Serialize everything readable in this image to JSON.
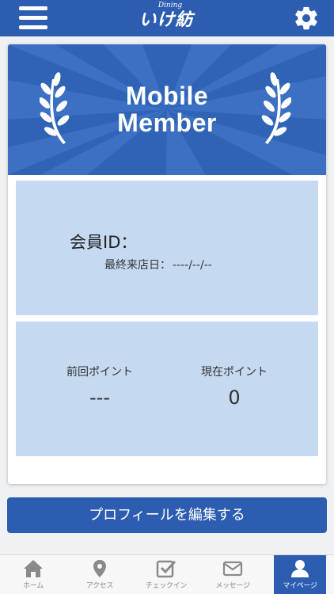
{
  "header": {
    "logo_small": "Dining",
    "logo_main": "いけ紡"
  },
  "banner": {
    "title_line1": "Mobile",
    "title_line2": "Member"
  },
  "member": {
    "id_label": "会員ID：",
    "last_visit_label": "最終来店日：",
    "last_visit_value": "----/--/--"
  },
  "points": {
    "previous_label": "前回ポイント",
    "previous_value": "---",
    "current_label": "現在ポイント",
    "current_value": "0"
  },
  "edit_profile_label": "プロフィールを編集する",
  "tabs": [
    {
      "label": "ホーム",
      "icon": "home-icon"
    },
    {
      "label": "アクセス",
      "icon": "map-pin-icon"
    },
    {
      "label": "チェックイン",
      "icon": "checkin-icon"
    },
    {
      "label": "メッセージ",
      "icon": "mail-icon"
    },
    {
      "label": "マイページ",
      "icon": "user-icon",
      "active": true
    }
  ],
  "colors": {
    "brand": "#2c5db0",
    "panel": "#c5d9f1"
  }
}
